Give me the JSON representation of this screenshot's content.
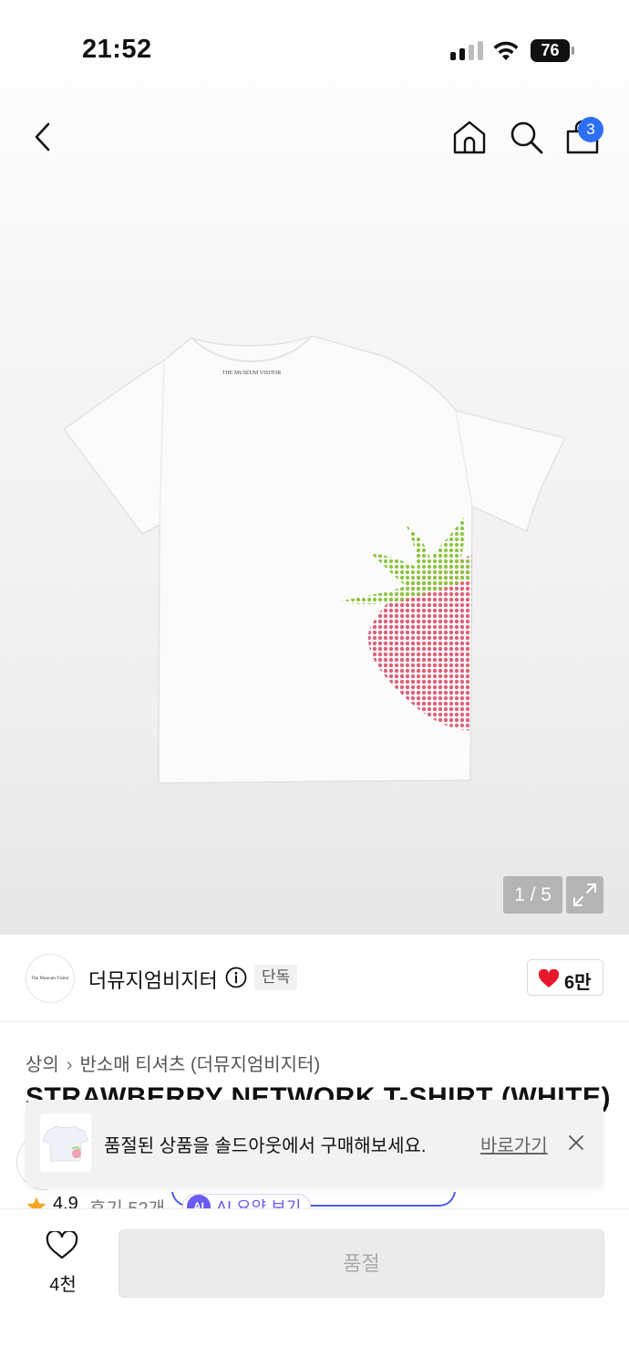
{
  "status_bar": {
    "time": "21:52",
    "battery": "76",
    "signal_bars_active": 2,
    "signal_bars_total": 4
  },
  "header": {
    "back_icon": "chevron-left-icon",
    "home_icon": "home-icon",
    "search_icon": "search-icon",
    "cart_icon": "shopping-bag-icon",
    "cart_badge": "3"
  },
  "gallery": {
    "counter": "1 / 5",
    "expand_icon": "expand-arrows-icon",
    "shirt_label": "THE MUSEUM VISITOR"
  },
  "brand": {
    "logo_text": "The Museum Visitor",
    "name": "더뮤지엄비지터",
    "tag": "단독",
    "likes": "6만"
  },
  "breadcrumb": {
    "category": "상의",
    "subcategory": "반소매 티셔츠 (더뮤지엄비지터)"
  },
  "product": {
    "title": "STRAWBERRY NETWORK T-SHIRT (WHITE)"
  },
  "toast": {
    "message": "품절된 상품을 솔드아웃에서 구매해보세요.",
    "link": "바로가기"
  },
  "rating": {
    "score": "4.9",
    "reviews": "후기 52개",
    "ai_badge": "AI",
    "ai_label": "AI 요약 보기"
  },
  "bottom_bar": {
    "wish_count": "4천",
    "buy_label": "품절"
  },
  "colors": {
    "accent_blue": "#2d6ff0",
    "heart_red": "#e8192c",
    "ai_purple": "#6a5cf2",
    "star_orange": "#f5a623"
  }
}
